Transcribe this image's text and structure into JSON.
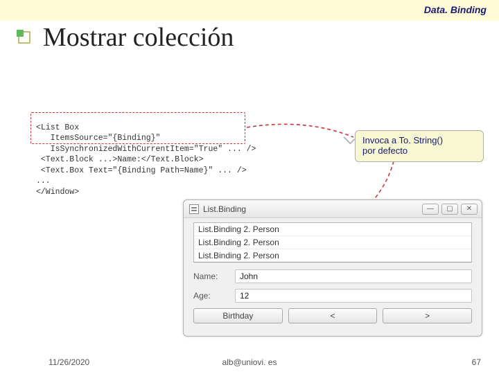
{
  "header_label": "Data. Binding",
  "slide_title": "Mostrar colección",
  "code_lines": [
    "<List Box",
    "   ItemsSource=\"{Binding}\"",
    "   IsSynchronizedWithCurrentItem=\"True\" ... />",
    " <Text.Block ...>Name:</Text.Block>",
    " <Text.Box Text=\"{Binding Path=Name}\" ... />",
    "...",
    "</Window>"
  ],
  "callout": {
    "line1": "Invoca a To. String()",
    "line2": "por defecto"
  },
  "app": {
    "title": "List.Binding",
    "list_items": [
      "List.Binding 2. Person",
      "List.Binding 2. Person",
      "List.Binding 2. Person"
    ],
    "name_label": "Name:",
    "name_value": "John",
    "age_label": "Age:",
    "age_value": "12",
    "buttons": {
      "birthday": "Birthday",
      "prev": "<",
      "next": ">"
    },
    "win_controls": {
      "min": "—",
      "max": "▢",
      "close": "✕"
    }
  },
  "footer": {
    "date": "11/26/2020",
    "email": "alb@uniovi. es",
    "page": "67"
  }
}
